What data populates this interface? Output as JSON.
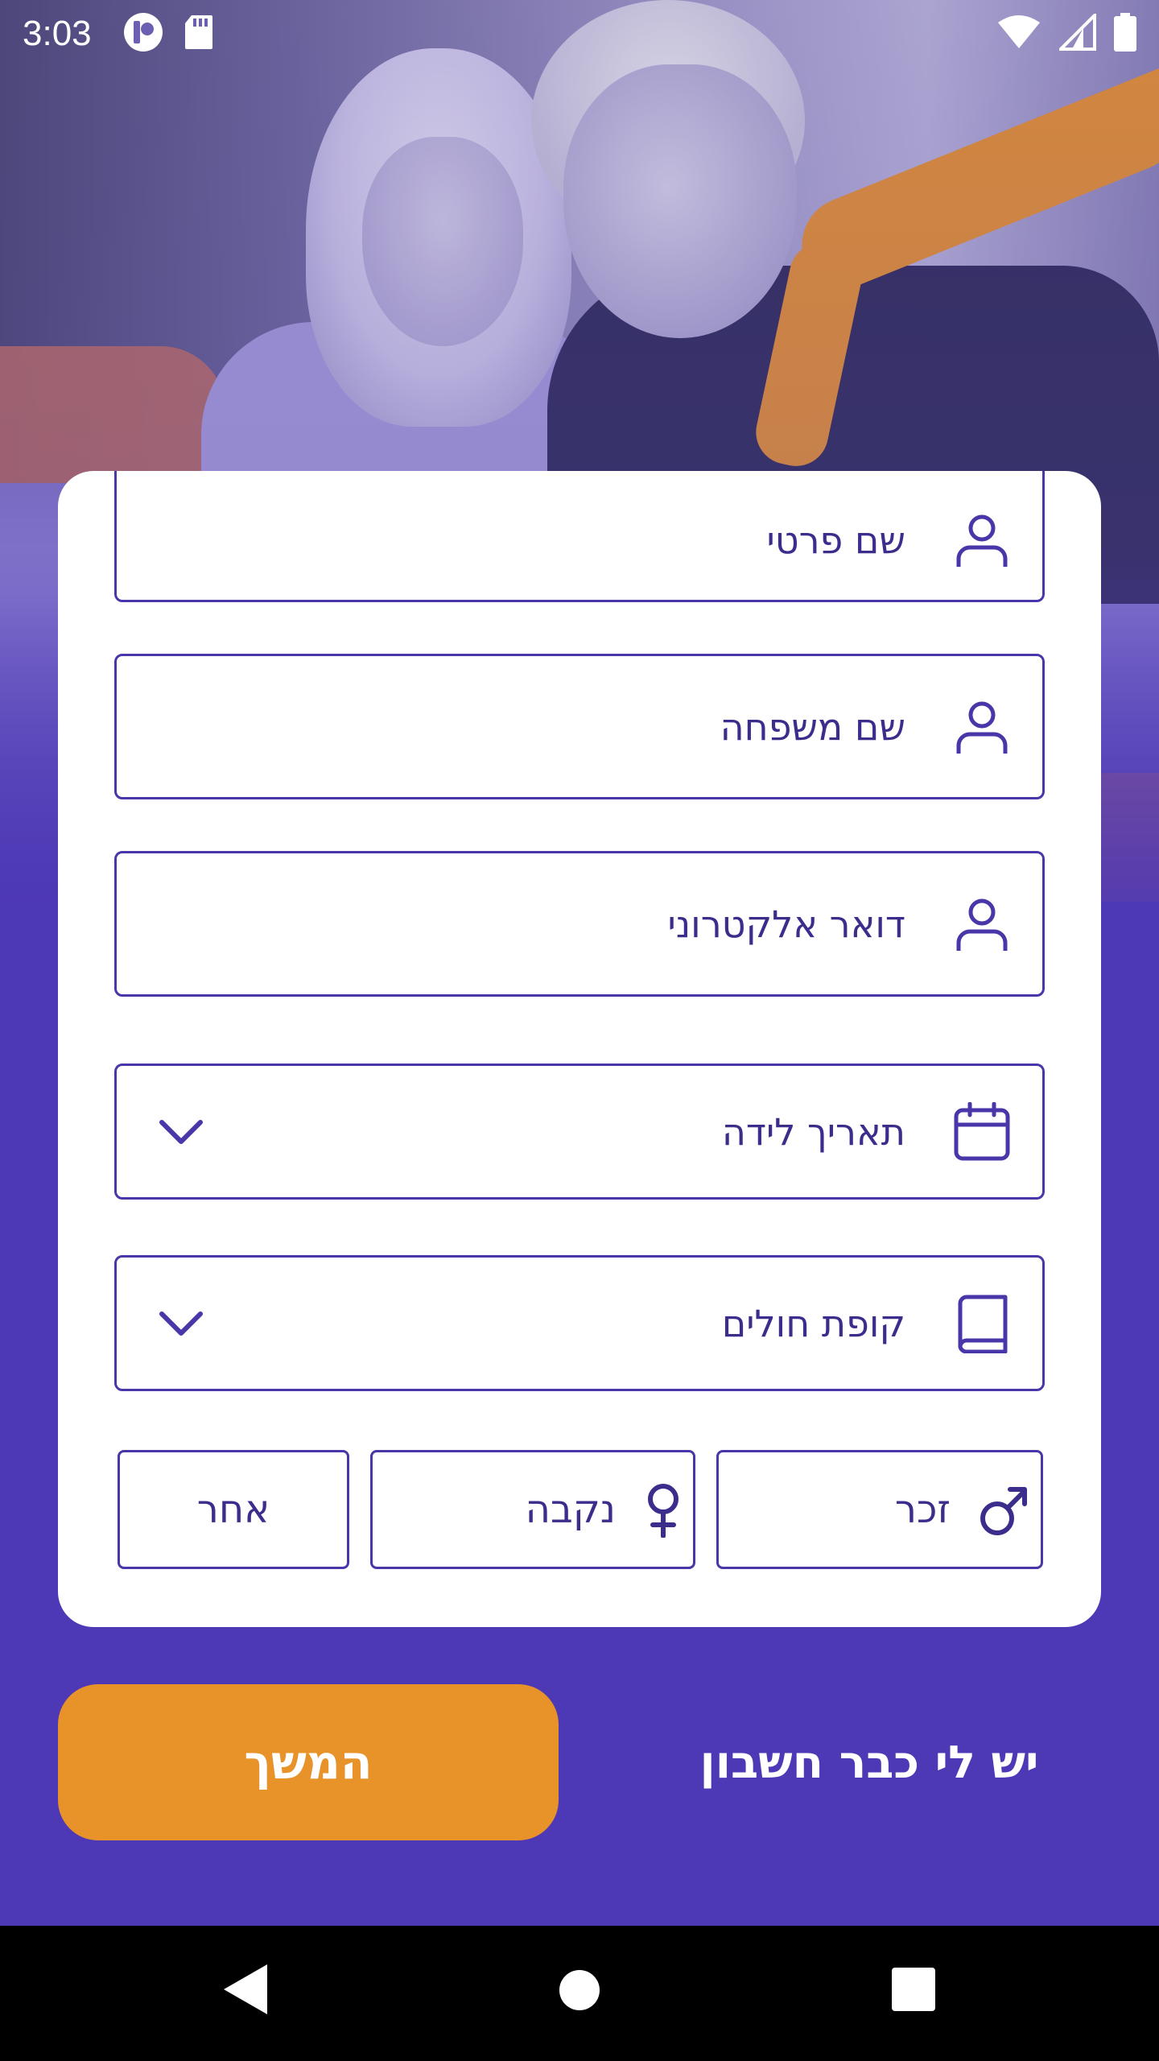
{
  "status_bar": {
    "time": "3:03",
    "left_icons": [
      "app-notification-icon",
      "sd-card-icon"
    ],
    "right_icons": [
      "wifi-icon",
      "cell-signal-icon",
      "battery-icon"
    ]
  },
  "form": {
    "first_name": {
      "label": "שם פרטי",
      "icon": "person-icon"
    },
    "last_name": {
      "label": "שם משפחה",
      "icon": "person-icon"
    },
    "email": {
      "label": "דואר אלקטרוני",
      "icon": "person-icon"
    },
    "birth_date": {
      "label": "תאריך לידה",
      "icon": "calendar-icon"
    },
    "health_fund": {
      "label": "קופת חולים",
      "icon": "book-icon"
    },
    "gender": {
      "male": {
        "label": "זכר",
        "icon": "male-icon"
      },
      "female": {
        "label": "נקבה",
        "icon": "female-icon"
      },
      "other": {
        "label": "אחר"
      }
    }
  },
  "actions": {
    "continue_label": "המשך",
    "have_account_label": "יש לי כבר חשבון"
  },
  "colors": {
    "brand_purple": "#4d38b5",
    "field_border": "#4a36a8",
    "accent_orange": "#e8922a"
  }
}
